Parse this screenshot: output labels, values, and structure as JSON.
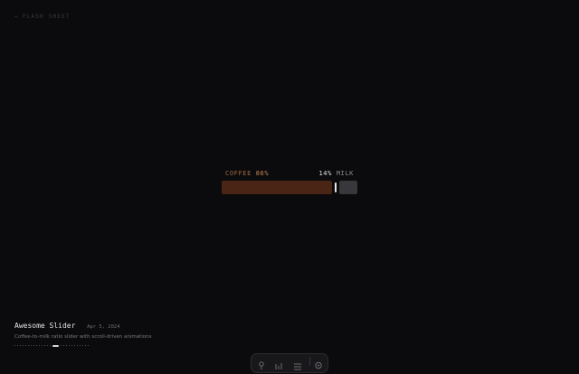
{
  "nav": {
    "back_arrow": "←",
    "back_label": "FLASH SHEET"
  },
  "slider": {
    "coffee_label": "COFFEE",
    "coffee_percent": "86%",
    "milk_percent": "14%",
    "milk_label": "MILK",
    "coffee_value": 86,
    "milk_value": 14,
    "colors": {
      "coffee_fill": "#4a2414",
      "coffee_text": "#a06a43",
      "milk_fill": "#38383c",
      "handle": "#e8e8e8"
    }
  },
  "project": {
    "title": "Awesome Slider",
    "date": "Apr 5, 2024",
    "description": "Coffee-to-milk ratio slider with scroll-driven animations"
  },
  "pagination": {
    "total": 26,
    "active_index": 14
  },
  "dock": {
    "icons": [
      "cursor-icon",
      "chart-icon",
      "list-icon",
      "settings-icon"
    ]
  }
}
